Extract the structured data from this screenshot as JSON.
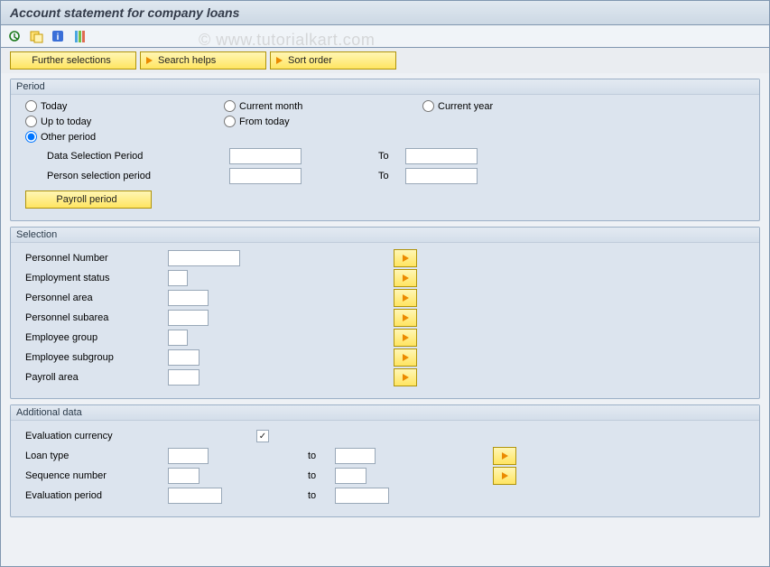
{
  "title": "Account statement for company loans",
  "watermark": "© www.tutorialkart.com",
  "toolbar_buttons": {
    "further_selections": "Further selections",
    "search_helps": "Search helps",
    "sort_order": "Sort order"
  },
  "groups": {
    "period": {
      "title": "Period",
      "radios": {
        "today": "Today",
        "current_month": "Current month",
        "current_year": "Current year",
        "up_to_today": "Up to today",
        "from_today": "From today",
        "other_period": "Other period"
      },
      "data_sel_label": "Data Selection Period",
      "person_sel_label": "Person selection period",
      "to": "To",
      "payroll_btn": "Payroll period"
    },
    "selection": {
      "title": "Selection",
      "rows": {
        "pernr": "Personnel Number",
        "emp_status": "Employment status",
        "pers_area": "Personnel area",
        "pers_subarea": "Personnel subarea",
        "emp_group": "Employee group",
        "emp_subgroup": "Employee subgroup",
        "payroll_area": "Payroll area"
      }
    },
    "additional": {
      "title": "Additional data",
      "eval_curr": "Evaluation currency",
      "loan_type": "Loan type",
      "seq_num": "Sequence number",
      "eval_period": "Evaluation period",
      "to": "to",
      "checked": "✓"
    }
  }
}
